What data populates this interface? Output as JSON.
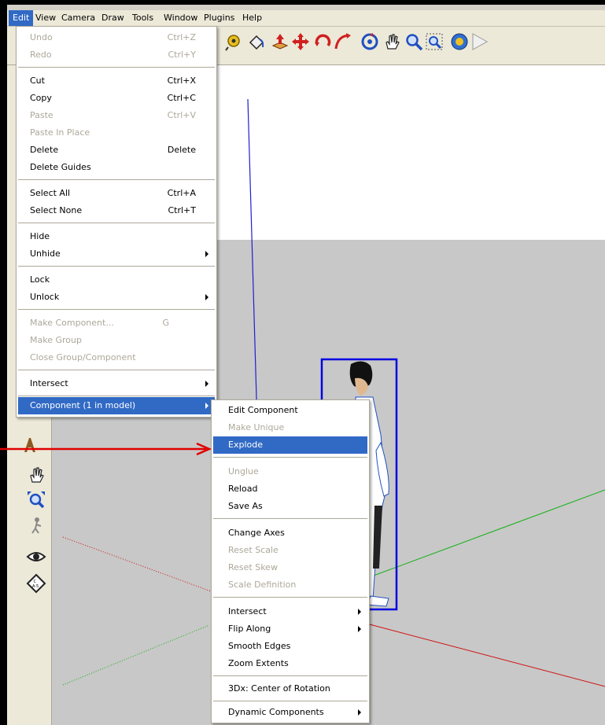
{
  "menubar": {
    "items": [
      "Edit",
      "View",
      "Camera",
      "Draw",
      "Tools",
      "Window",
      "Plugins",
      "Help"
    ],
    "active": "Edit"
  },
  "edit_menu": {
    "undo": {
      "label": "Undo",
      "shortcut": "Ctrl+Z"
    },
    "redo": {
      "label": "Redo",
      "shortcut": "Ctrl+Y"
    },
    "cut": {
      "label": "Cut",
      "shortcut": "Ctrl+X"
    },
    "copy": {
      "label": "Copy",
      "shortcut": "Ctrl+C"
    },
    "paste": {
      "label": "Paste",
      "shortcut": "Ctrl+V"
    },
    "paste_in_place": {
      "label": "Paste In Place"
    },
    "delete": {
      "label": "Delete",
      "shortcut": "Delete"
    },
    "delete_guides": {
      "label": "Delete Guides"
    },
    "select_all": {
      "label": "Select All",
      "shortcut": "Ctrl+A"
    },
    "select_none": {
      "label": "Select None",
      "shortcut": "Ctrl+T"
    },
    "hide": {
      "label": "Hide"
    },
    "unhide": {
      "label": "Unhide"
    },
    "lock": {
      "label": "Lock"
    },
    "unlock": {
      "label": "Unlock"
    },
    "make_component": {
      "label": "Make Component...",
      "shortcut": "G"
    },
    "make_group": {
      "label": "Make Group"
    },
    "close_group": {
      "label": "Close Group/Component"
    },
    "intersect": {
      "label": "Intersect"
    },
    "component": {
      "label": "Component (1 in model)"
    }
  },
  "component_menu": {
    "edit_component": "Edit Component",
    "make_unique": "Make Unique",
    "explode": "Explode",
    "unglue": "Unglue",
    "reload": "Reload",
    "save_as": "Save As",
    "change_axes": "Change Axes",
    "reset_scale": "Reset Scale",
    "reset_skew": "Reset Skew",
    "scale_definition": "Scale Definition",
    "intersect": "Intersect",
    "flip_along": "Flip Along",
    "smooth_edges": "Smooth Edges",
    "zoom_extents": "Zoom Extents",
    "center_of_rotation": "3Dx: Center of Rotation",
    "dynamic_components": "Dynamic Components"
  },
  "colors": {
    "menu_highlight": "#316ac5",
    "annotation_arrow": "#e00000",
    "blue_axis": "#1f1fd0",
    "green_axis": "#10b010",
    "red_axis": "#d01010"
  }
}
